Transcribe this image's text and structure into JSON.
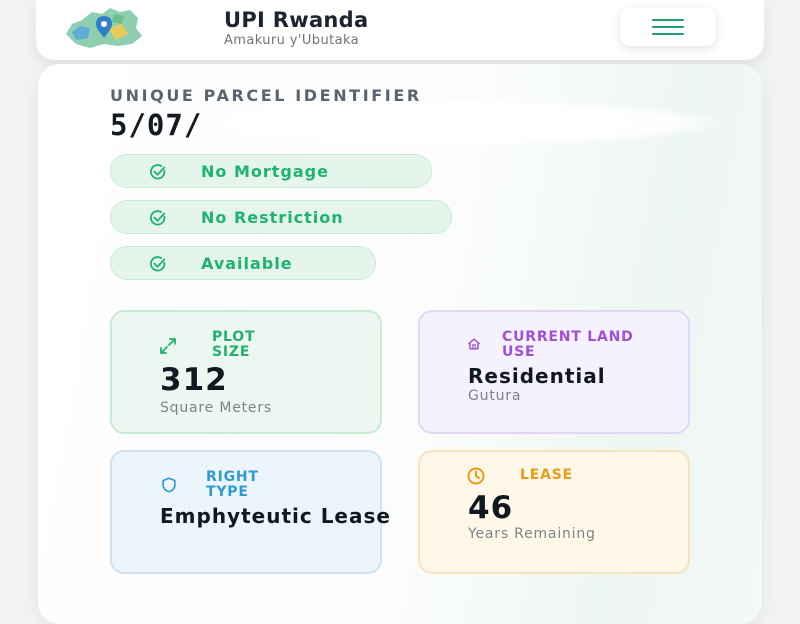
{
  "header": {
    "title": "UPI Rwanda",
    "subtitle": "Amakuru y'Ubutaka",
    "logo_icon": "rwanda-map-pin-logo",
    "menu_icon": "hamburger-menu-icon"
  },
  "parcel": {
    "label": "UNIQUE PARCEL IDENTIFIER",
    "value": "5/07/"
  },
  "badges": [
    {
      "label": "No Mortgage",
      "icon": "check-circle-icon"
    },
    {
      "label": "No Restriction",
      "icon": "check-circle-icon"
    },
    {
      "label": "Available",
      "icon": "check-circle-icon"
    }
  ],
  "tiles": {
    "plot_size": {
      "label": "PLOT SIZE",
      "value": "312",
      "sub": "Square Meters",
      "icon": "expand-arrows-icon"
    },
    "land_use": {
      "label": "CURRENT LAND USE",
      "value": "Residential",
      "sub": "Gutura",
      "icon": "home-icon"
    },
    "right_type": {
      "label": "RIGHT TYPE",
      "value": "Emphyteutic Lease",
      "icon": "shield-icon"
    },
    "lease": {
      "label": "LEASE",
      "value": "46",
      "sub": "Years Remaining",
      "icon": "clock-icon"
    }
  },
  "colors": {
    "accent_green": "#1eb36f",
    "purple": "#a050d6",
    "blue": "#2e9ad2",
    "orange": "#e99b1a"
  }
}
